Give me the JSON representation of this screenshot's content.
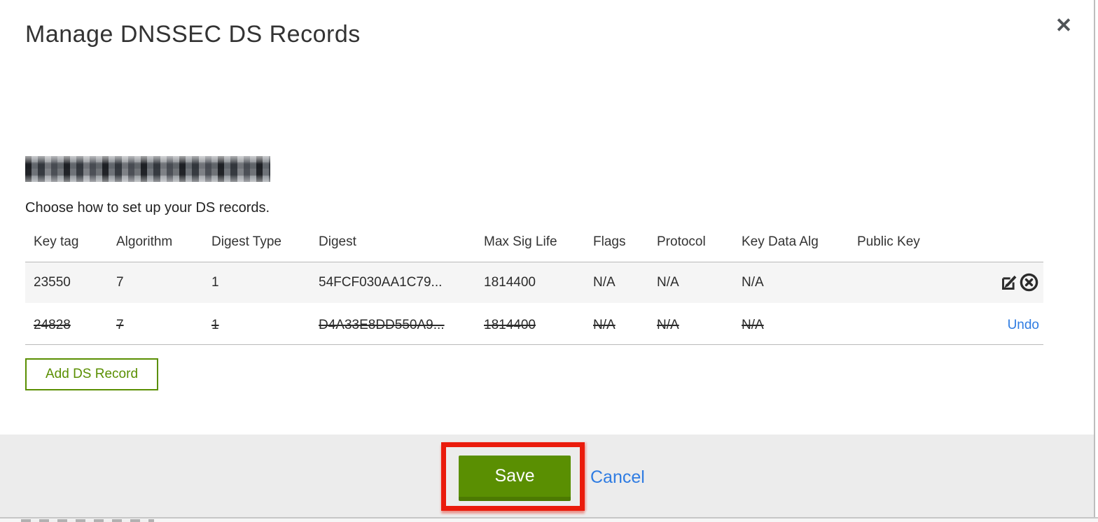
{
  "modal": {
    "title": "Manage DNSSEC DS Records",
    "subtitle": "Choose how to set up your DS records.",
    "domain_display": "(redacted domain name)"
  },
  "icons": {
    "close": "✕",
    "row_actions": [
      "edit-icon",
      "circle-x-delete-icon"
    ]
  },
  "table": {
    "columns": [
      "Key tag",
      "Algorithm",
      "Digest Type",
      "Digest",
      "Max Sig Life",
      "Flags",
      "Protocol",
      "Key Data Alg",
      "Public Key"
    ],
    "rows": [
      {
        "key_tag": "23550",
        "algorithm": "7",
        "digest_type": "1",
        "digest": "54FCF030AA1C79...",
        "max_sig_life": "1814400",
        "flags": "N/A",
        "protocol": "N/A",
        "key_data_alg": "N/A",
        "public_key": "",
        "state": "normal"
      },
      {
        "key_tag": "24828",
        "algorithm": "7",
        "digest_type": "1",
        "digest": "D4A33E8DD550A9...",
        "max_sig_life": "1814400",
        "flags": "N/A",
        "protocol": "N/A",
        "key_data_alg": "N/A",
        "public_key": "",
        "state": "deleted",
        "undo_label": "Undo"
      }
    ]
  },
  "buttons": {
    "add_ds_record": "Add DS Record",
    "save": "Save",
    "cancel": "Cancel"
  },
  "colors": {
    "accent_green": "#5a8f02",
    "accent_green_dark": "#4c7a02",
    "link_blue": "#2f7ce2",
    "annotation_red": "#ea1b0c",
    "row_gray": "#f5f5f5",
    "footer_gray": "#ececec"
  }
}
